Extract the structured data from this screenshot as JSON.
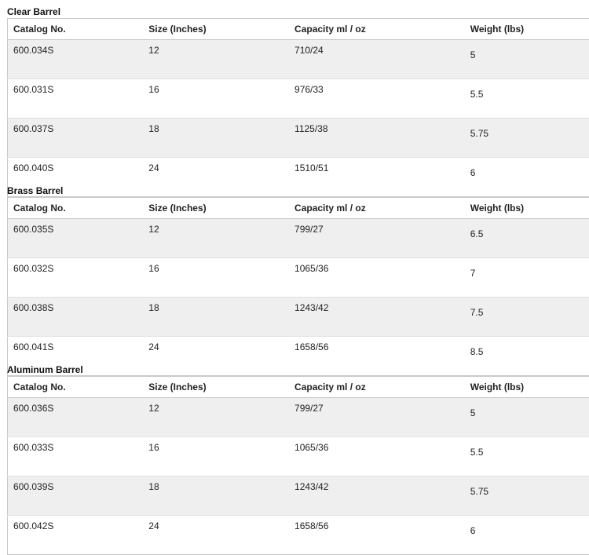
{
  "columns": [
    "Catalog No.",
    "Size (Inches)",
    "Capacity ml / oz",
    "Weight (lbs)"
  ],
  "sections": [
    {
      "title": "Clear Barrel",
      "rows": [
        [
          "600.034S",
          "12",
          "710/24",
          "5"
        ],
        [
          "600.031S",
          "16",
          "976/33",
          "5.5"
        ],
        [
          "600.037S",
          "18",
          "1125/38",
          "5.75"
        ],
        [
          "600.040S",
          "24",
          "1510/51",
          "6"
        ]
      ]
    },
    {
      "title": "Brass Barrel",
      "rows": [
        [
          "600.035S",
          "12",
          "799/27",
          "6.5"
        ],
        [
          "600.032S",
          "16",
          "1065/36",
          "7"
        ],
        [
          "600.038S",
          "18",
          "1243/42",
          "7.5"
        ],
        [
          "600.041S",
          "24",
          "1658/56",
          "8.5"
        ]
      ]
    },
    {
      "title": "Aluminum Barrel",
      "rows": [
        [
          "600.036S",
          "12",
          "799/27",
          "5"
        ],
        [
          "600.033S",
          "16",
          "1065/36",
          "5.5"
        ],
        [
          "600.039S",
          "18",
          "1243/42",
          "5.75"
        ],
        [
          "600.042S",
          "24",
          "1658/56",
          "6"
        ]
      ]
    }
  ]
}
